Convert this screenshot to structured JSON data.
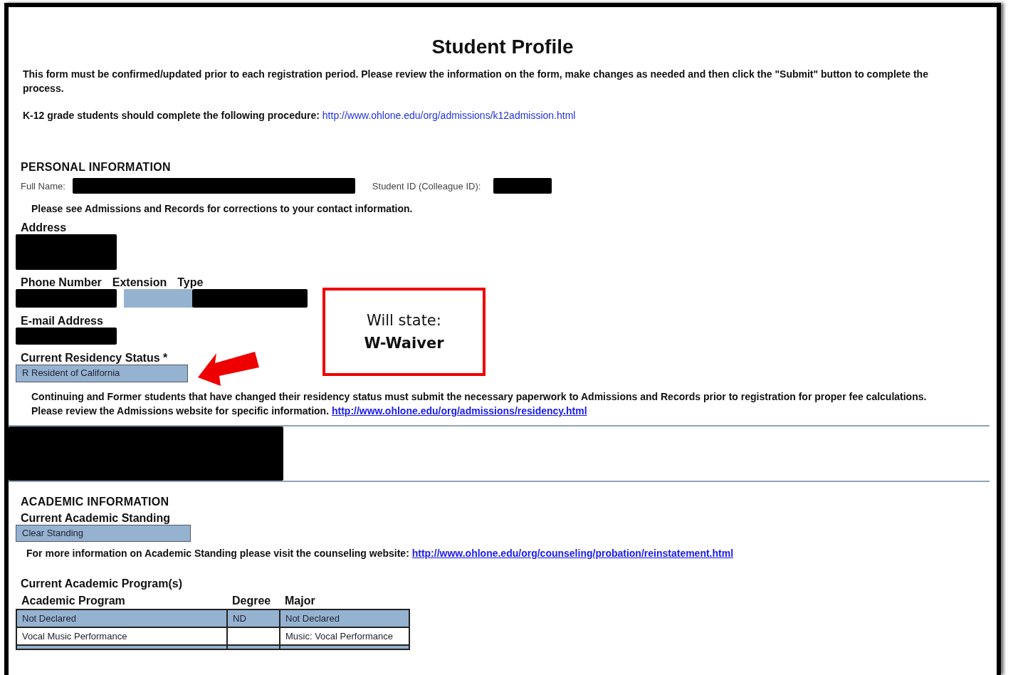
{
  "title": "Student Profile",
  "intro": "This form must be confirmed/updated prior to each registration period. Please review the information on the form, make changes as needed and then click the \"Submit\" button to complete the process.",
  "k12": {
    "text": "K-12 grade students should complete the following procedure:",
    "link": "http://www.ohlone.edu/org/admissions/k12admission.html"
  },
  "personal": {
    "heading": "PERSONAL INFORMATION",
    "full_name_label": "Full Name:",
    "student_id_label": "Student ID (Colleague ID):",
    "note": "Please see Admissions and Records for corrections to your contact information.",
    "address_label": "Address",
    "phone_columns": [
      "Phone Number",
      "Extension",
      "Type"
    ],
    "email_label": "E-mail Address",
    "residency_label": "Current Residency Status *",
    "residency_value": "R Resident of California",
    "residency_note": "Continuing and Former students that have changed their residency status must submit the necessary paperwork to Admissions and Records prior to registration for proper fee calculations. Please review the Admissions website for specific information.",
    "residency_link": "http://www.ohlone.edu/org/admissions/residency.html"
  },
  "academic": {
    "heading": "ACADEMIC INFORMATION",
    "standing_label": "Current Academic Standing",
    "standing_value": "Clear Standing",
    "more_info": "For more information on Academic Standing please visit the counseling website:",
    "more_info_link": "http://www.ohlone.edu/org/counseling/probation/reinstatement.html",
    "programs_heading": "Current Academic Program(s)",
    "columns": [
      "Academic Program",
      "Degree",
      "Major"
    ],
    "rows": [
      {
        "cells": [
          "Not Declared",
          "ND",
          "Not Declared"
        ],
        "selected": true
      },
      {
        "cells": [
          "Vocal Music Performance",
          "",
          "Music: Vocal Performance"
        ],
        "selected": false
      }
    ]
  },
  "callout": {
    "line1": "Will state:",
    "line2": "W-Waiver"
  }
}
